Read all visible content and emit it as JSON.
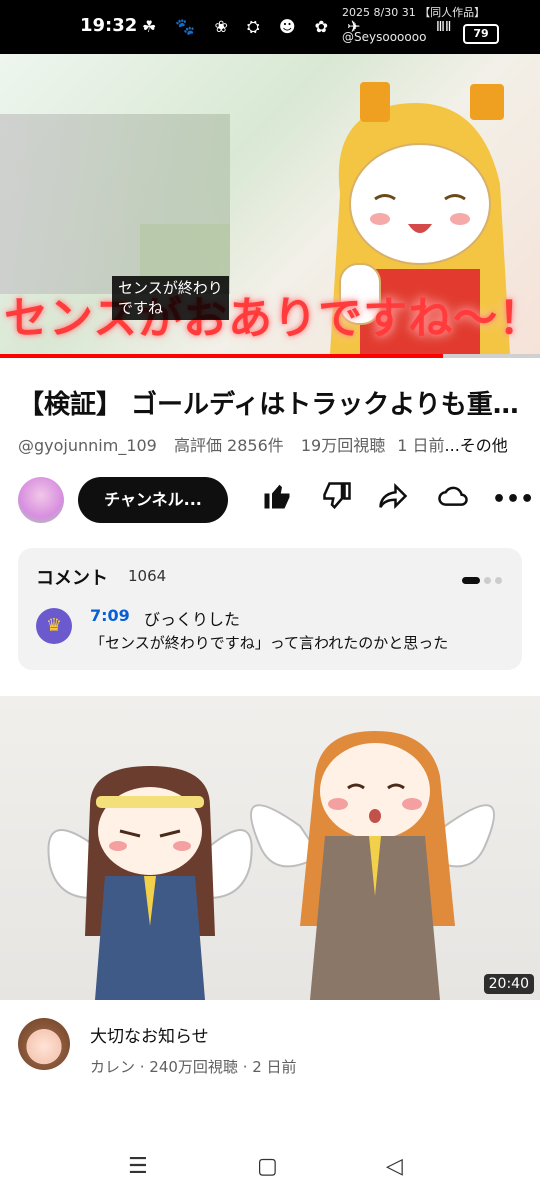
{
  "status_bar": {
    "time": "19:32",
    "notification_icons": "☘ 🐾 ❀ ⛭ ☻ ✿ ✈",
    "watermark_line1": "2025 8/30 31",
    "watermark_tag": "【同人作品】",
    "watermark_line2": "@Seysoooooo",
    "signal": "ⅢⅡ",
    "battery": "79"
  },
  "video": {
    "subtitle_line1": "センスが終わり",
    "subtitle_line2": "ですね",
    "overlay_text": "センスがおありですね～！",
    "progress_fraction": 0.82
  },
  "details": {
    "title": "【検証】 ゴールディはトラックよりも重…",
    "channel_handle": "@gyojunnim_109",
    "likes": "高評価 2856件",
    "views": "19万回視聴",
    "age": "1 日前",
    "more": "...その他"
  },
  "channel_row": {
    "channel_button": "チャンネル...",
    "like_icon": "thumb-up",
    "dislike_icon": "thumb-down",
    "share_icon": "share",
    "remix_icon": "remix",
    "more_icon": "more"
  },
  "comments": {
    "header": "コメント",
    "count": "1064",
    "timestamp": "7:09",
    "first_line": "びっくりした",
    "second_line": "「センスが終わりですね」って言われたのかと思った"
  },
  "next_video": {
    "duration": "20:40",
    "title": "大切なお知らせ",
    "meta": "カレン · 240万回視聴 · 2 日前"
  },
  "nav_bar": {
    "menu": "☰",
    "home": "▢",
    "back": "◁"
  }
}
